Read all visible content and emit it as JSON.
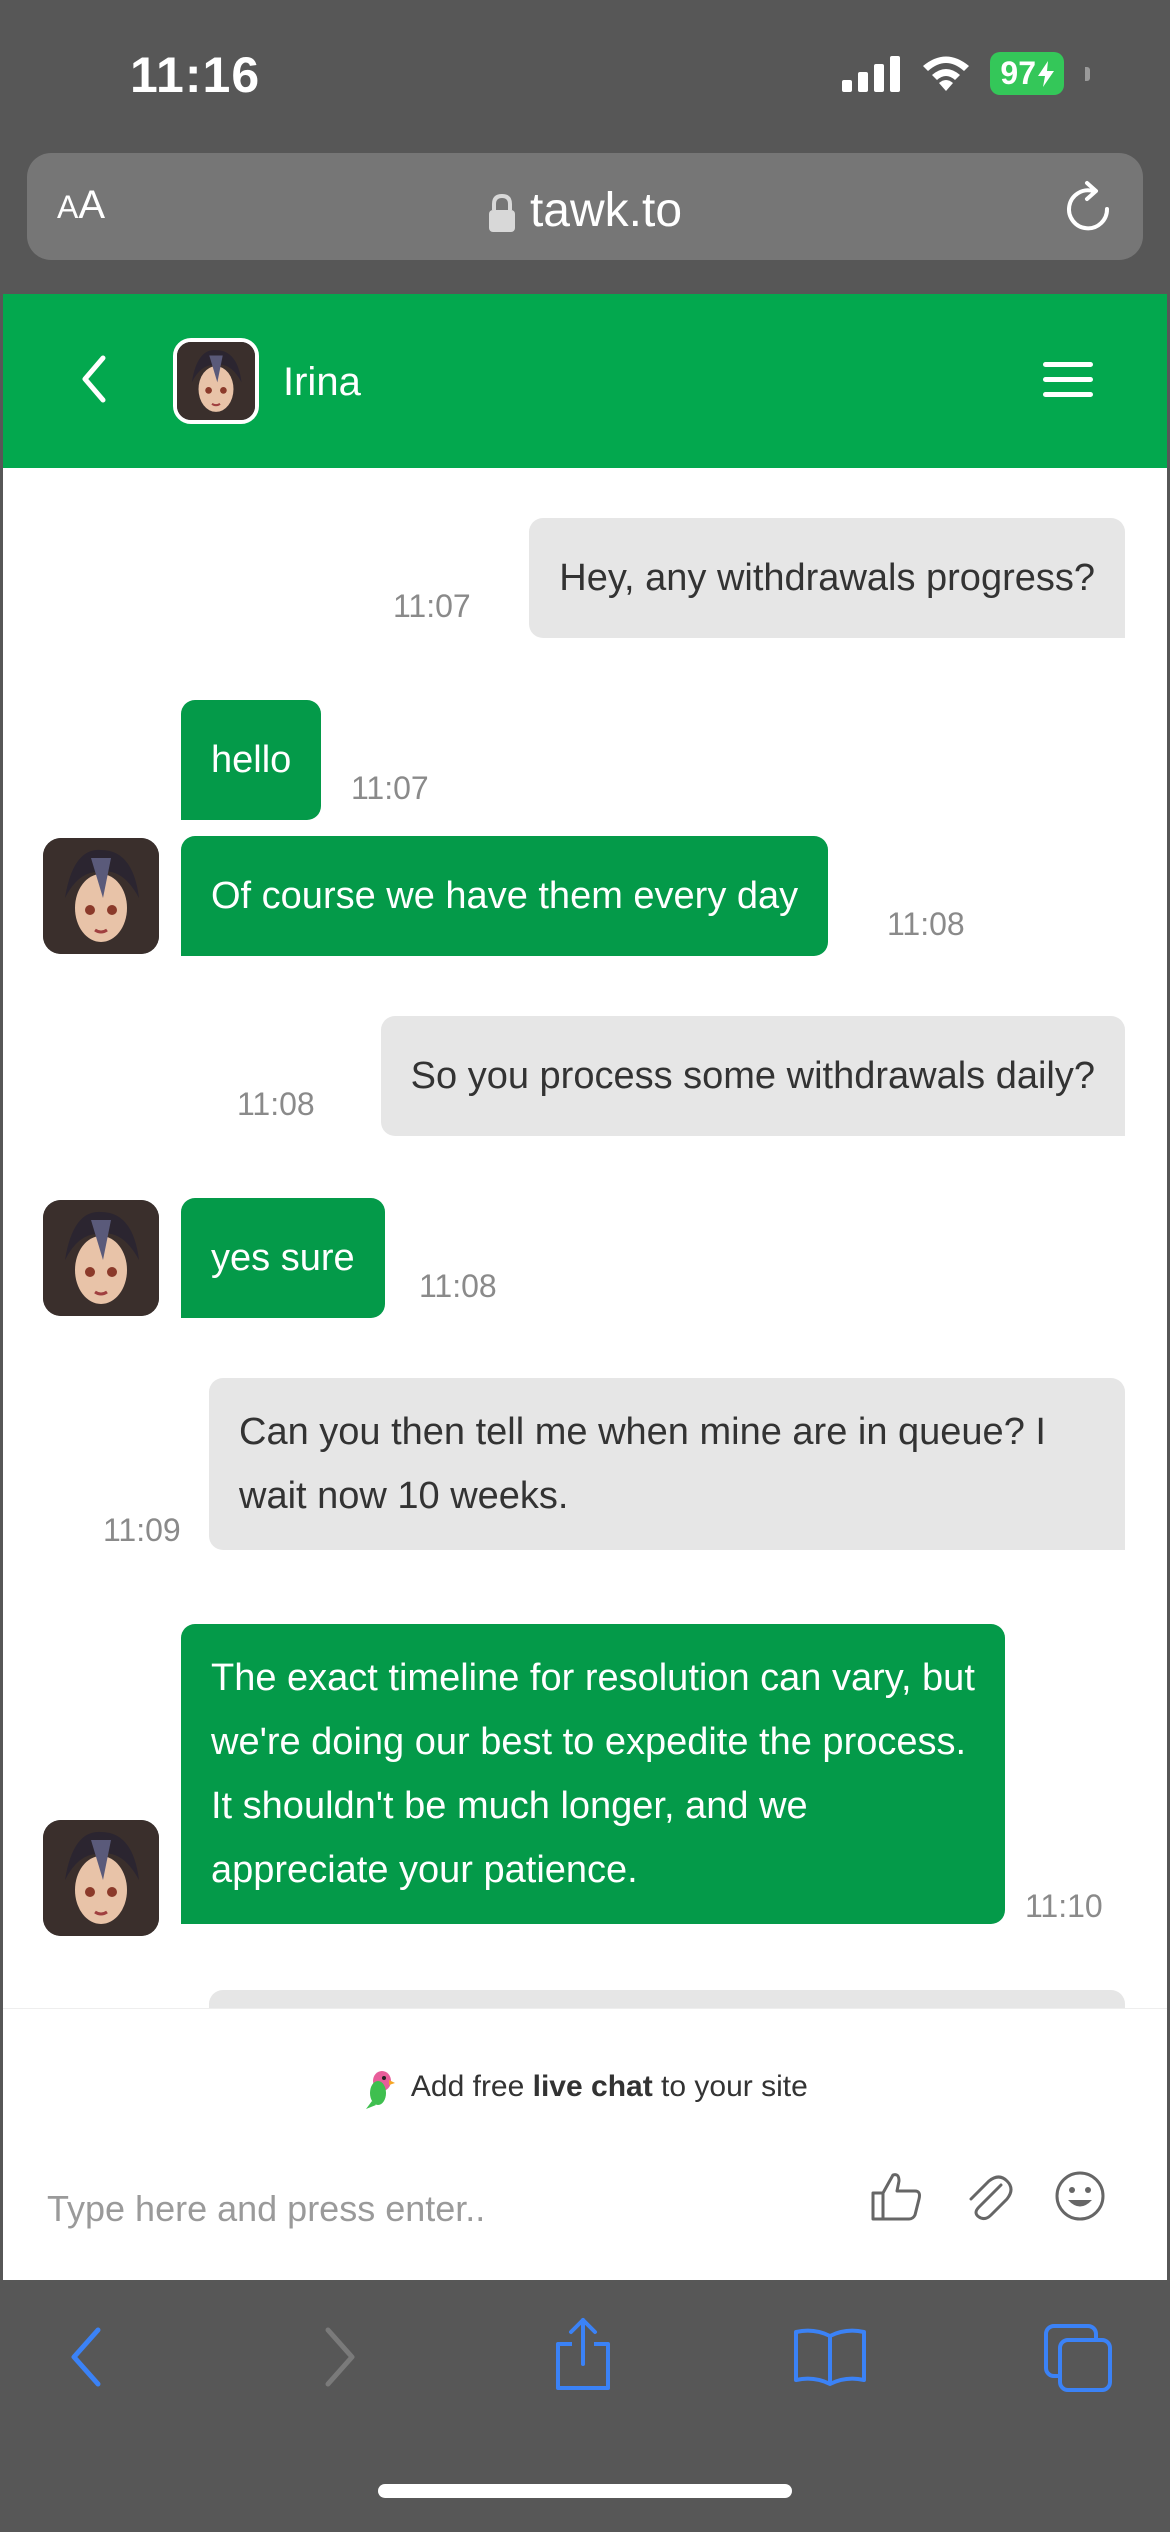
{
  "status_bar": {
    "time": "11:16",
    "battery": "97"
  },
  "browser": {
    "aa_label_small": "A",
    "aa_label_large": "A",
    "url": "tawk.to"
  },
  "chat_header": {
    "agent_name": "Irina"
  },
  "messages": [
    {
      "sender": "visitor",
      "text": "Hey, any withdrawals progress?",
      "time": "11:07"
    },
    {
      "sender": "agent",
      "text": "hello",
      "time": "11:07"
    },
    {
      "sender": "agent",
      "text": "Of course we have them every day",
      "time": "11:08"
    },
    {
      "sender": "visitor",
      "text": "So you process some withdrawals daily?",
      "time": "11:08"
    },
    {
      "sender": "agent",
      "text": "yes sure",
      "time": "11:08"
    },
    {
      "sender": "visitor",
      "text": "Can you then tell me when mine are in queue? I wait now 10 weeks.",
      "time": "11:09"
    },
    {
      "sender": "agent",
      "text": "The exact timeline for resolution can vary, but we're doing our best to expedite the process. It shouldn't be much longer, and we appreciate your patience.",
      "time": "11:10"
    }
  ],
  "footer": {
    "branding_pre": "Add free ",
    "branding_bold": "live chat",
    "branding_post": " to your site",
    "input_placeholder": "Type here and press enter.."
  },
  "colors": {
    "brand_green": "#03a84e",
    "agent_bubble": "#049a49",
    "visitor_bubble": "#e6e6e6",
    "safari_blue": "#3b82f6"
  },
  "icons": [
    "back-chevron-icon",
    "hamburger-menu-icon",
    "thumbs-up-icon",
    "paperclip-icon",
    "emoji-icon",
    "lock-icon",
    "reload-icon",
    "share-icon",
    "bookmarks-icon",
    "tabs-icon"
  ]
}
